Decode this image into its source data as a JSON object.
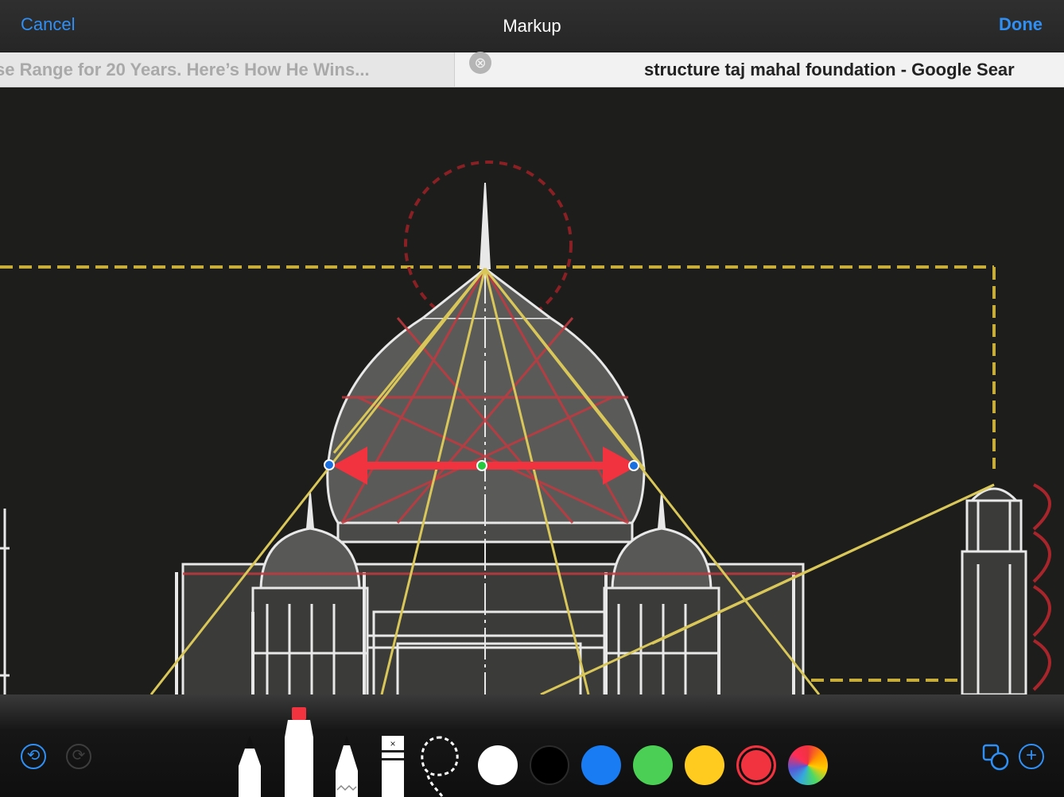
{
  "nav": {
    "cancel_label": "Cancel",
    "title": "Markup",
    "done_label": "Done"
  },
  "tabs": {
    "inactive_title": "se Range for 20 Years. Here’s How He Wins...",
    "active_title": "structure taj mahal foundation - Google Sear",
    "close_icon": "⊗"
  },
  "toolbar": {
    "undo_icon": "undo-icon",
    "redo_icon": "redo-icon",
    "tools": [
      "pen",
      "marker",
      "pencil",
      "eraser",
      "lasso"
    ],
    "selected_tool": "marker",
    "colors": [
      "#ffffff",
      "#000000",
      "#1a7cf2",
      "#4ccf55",
      "#ffcb1f",
      "#f0333f",
      "multicolor"
    ],
    "selected_color": "#f0333f",
    "shapes_icon": "shapes-icon",
    "add_icon": "+"
  },
  "annotation": {
    "type": "double-arrow",
    "color": "#f0333f"
  },
  "colors": {
    "accent": "#2f8ff5",
    "drawing_line": "#e8e8e8",
    "guide_yellow": "#d9c75a",
    "guide_red": "#b0262c"
  }
}
